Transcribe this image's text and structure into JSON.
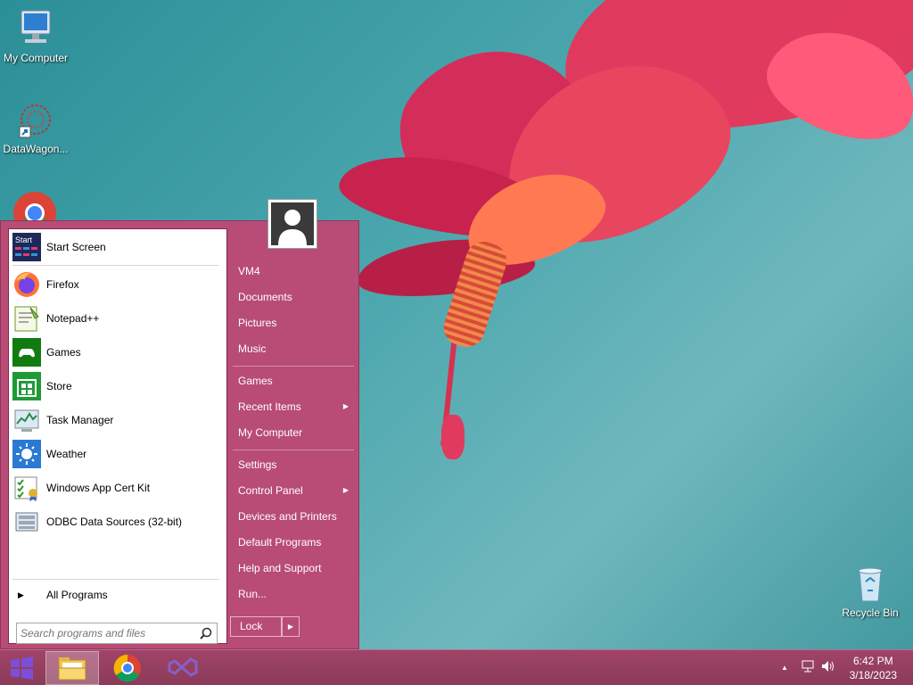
{
  "desktop": {
    "icons": [
      {
        "label": "My Computer"
      },
      {
        "label": "DataWagon..."
      },
      {
        "label": "Recycle Bin"
      }
    ]
  },
  "start_menu": {
    "pinned": [
      {
        "label": "Start Screen",
        "icon": "start-screen-icon"
      },
      {
        "label": "Firefox",
        "icon": "firefox-icon"
      },
      {
        "label": "Notepad++",
        "icon": "notepad-plus-plus-icon"
      },
      {
        "label": "Games",
        "icon": "games-icon"
      },
      {
        "label": "Store",
        "icon": "store-icon"
      },
      {
        "label": "Task Manager",
        "icon": "task-manager-icon"
      },
      {
        "label": "Weather",
        "icon": "weather-icon"
      },
      {
        "label": "Windows App Cert Kit",
        "icon": "app-cert-kit-icon"
      },
      {
        "label": "ODBC Data Sources (32-bit)",
        "icon": "odbc-icon"
      }
    ],
    "all_programs": "All Programs",
    "search_placeholder": "Search programs and files",
    "right_items": [
      {
        "label": "VM4"
      },
      {
        "label": "Documents"
      },
      {
        "label": "Pictures"
      },
      {
        "label": "Music"
      },
      {
        "label": "Games"
      },
      {
        "label": "Recent Items",
        "submenu": true
      },
      {
        "label": "My Computer"
      },
      {
        "label": "Settings"
      },
      {
        "label": "Control Panel",
        "submenu": true
      },
      {
        "label": "Devices and Printers"
      },
      {
        "label": "Default Programs"
      },
      {
        "label": "Help and Support"
      },
      {
        "label": "Run..."
      }
    ],
    "lock_label": "Lock",
    "submenu_arrow": "▶",
    "triangle": "▶"
  },
  "taskbar": {
    "apps": [
      "file-explorer-icon",
      "chrome-icon",
      "visual-studio-icon"
    ],
    "tray_arrow": "▲",
    "time": "6:42 PM",
    "date": "3/18/2023"
  },
  "colors": {
    "accent": "#b84c77",
    "taskbar": "#963f62"
  }
}
